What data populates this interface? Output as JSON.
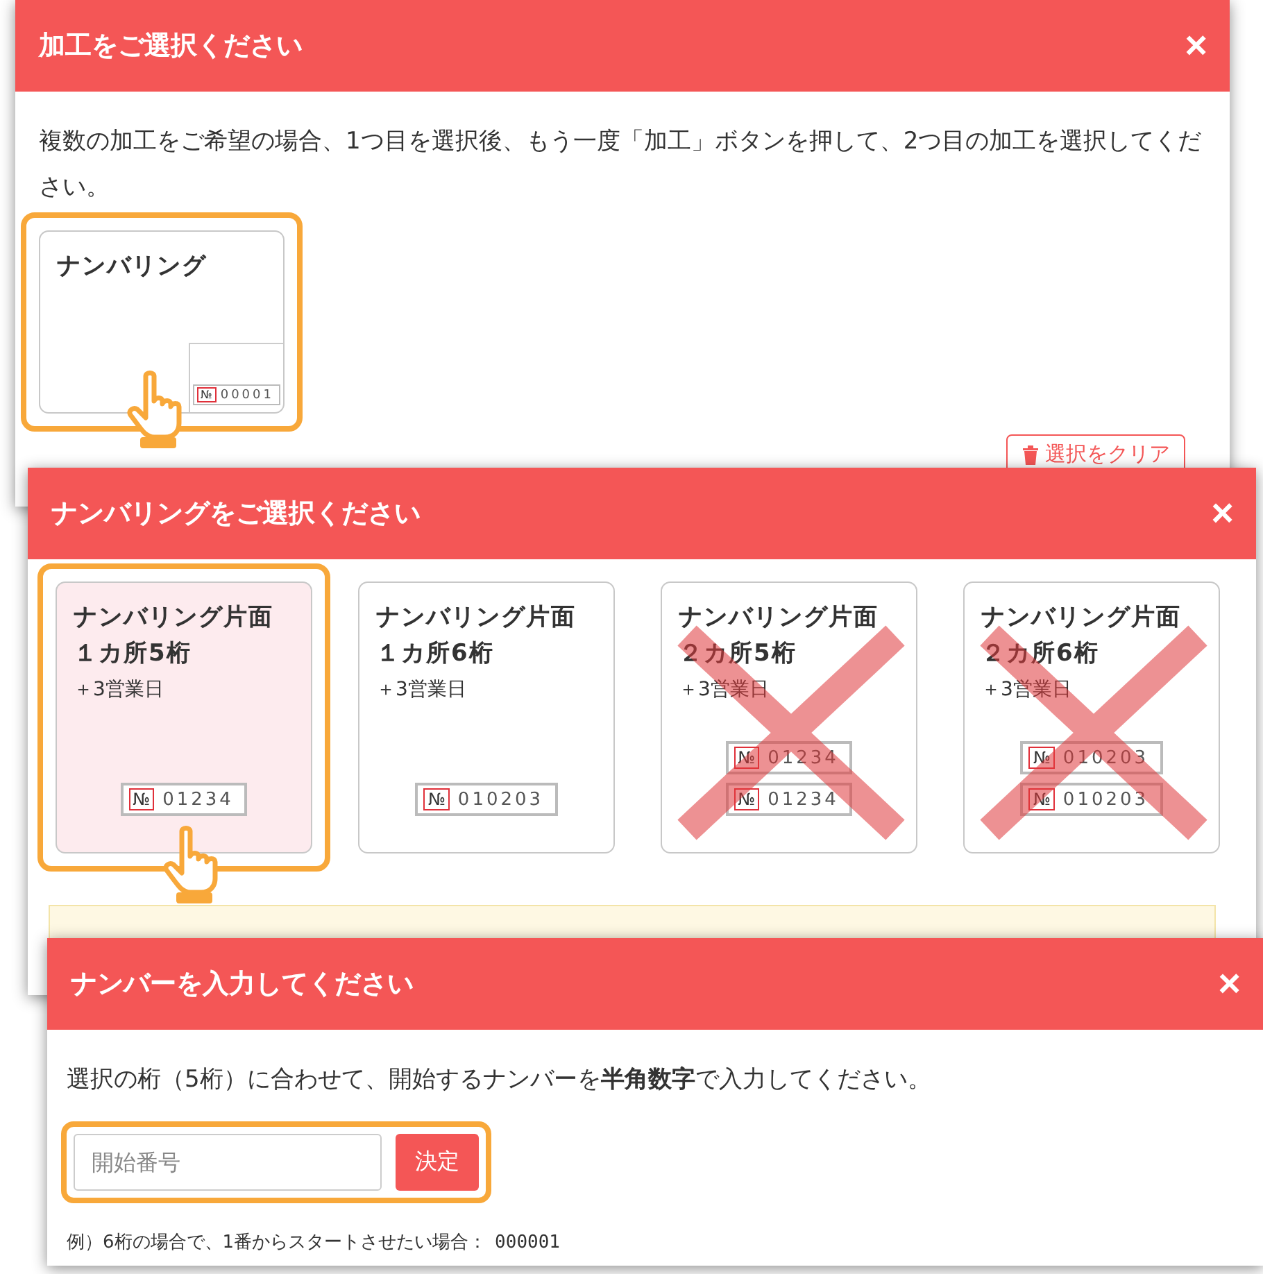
{
  "dialogs": [
    {
      "kind": "process",
      "title": "加工をご選択ください",
      "close": "×",
      "message": "複数の加工をご希望の場合、1つ目を選択後、もう一度「加工」ボタンを押して、2つ目の加工を選択してください。",
      "cards": [
        {
          "title": [
            "ナンバリング"
          ],
          "selected": false,
          "highlighted": true,
          "disabled": false,
          "samples": [
            {
              "mark": "№",
              "number": "00001"
            }
          ]
        }
      ],
      "clear_button": "選択をクリア"
    },
    {
      "kind": "numbering",
      "title": "ナンバリングをご選択ください",
      "close": "×",
      "cards": [
        {
          "title": [
            "ナンバリング片面",
            "１カ所5桁"
          ],
          "note": "＋3営業日",
          "selected": true,
          "highlighted": true,
          "disabled": false,
          "samples": [
            {
              "mark": "№",
              "number": "01234"
            }
          ]
        },
        {
          "title": [
            "ナンバリング片面",
            "１カ所6桁"
          ],
          "note": "＋3営業日",
          "selected": false,
          "highlighted": false,
          "disabled": false,
          "samples": [
            {
              "mark": "№",
              "number": "010203"
            }
          ]
        },
        {
          "title": [
            "ナンバリング片面",
            "２カ所5桁"
          ],
          "note": "＋3営業日",
          "selected": false,
          "highlighted": false,
          "disabled": true,
          "samples": [
            {
              "mark": "№",
              "number": "01234"
            },
            {
              "mark": "№",
              "number": "01234"
            }
          ]
        },
        {
          "title": [
            "ナンバリング片面",
            "２カ所6桁"
          ],
          "note": "＋3営業日",
          "selected": false,
          "highlighted": false,
          "disabled": true,
          "samples": [
            {
              "mark": "№",
              "number": "010203"
            },
            {
              "mark": "№",
              "number": "010203"
            }
          ]
        }
      ]
    },
    {
      "kind": "input",
      "title": "ナンバーを入力してください",
      "close": "×",
      "message": "選択の桁（5桁）に合わせて、開始するナンバーを**半角数字**で入力してください。",
      "input": {
        "placeholder": "開始番号",
        "highlighted": true
      },
      "submit_button": "決定",
      "example": "例）6桁の場合で、1番からスタートさせたい場合：",
      "example_value": "000001"
    }
  ]
}
